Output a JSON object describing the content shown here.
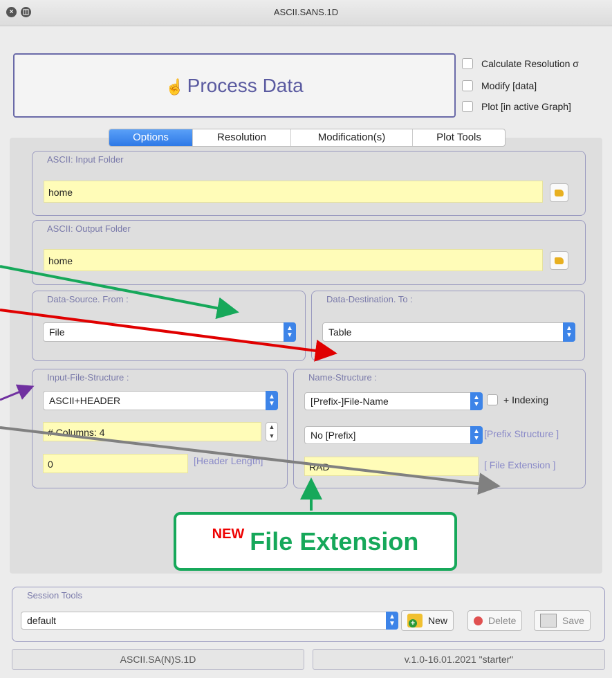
{
  "window": {
    "title": "ASCII.SANS.1D"
  },
  "process": {
    "label": "Process Data"
  },
  "checkboxes": [
    "Calculate Resolution σ",
    "Modify [data]",
    "Plot [in active Graph]"
  ],
  "tabs": [
    "Options",
    "Resolution",
    "Modification(s)",
    "Plot Tools"
  ],
  "input_folder": {
    "title": "ASCII: Input Folder",
    "value": "home"
  },
  "output_folder": {
    "title": "ASCII: Output Folder",
    "value": "home"
  },
  "data_source": {
    "title": "Data-Source. From :",
    "value": "File"
  },
  "data_destination": {
    "title": "Data-Destination. To :",
    "value": "Table"
  },
  "input_structure": {
    "title": "Input-File-Structure :",
    "format": "ASCII+HEADER",
    "columns": "# Columns:  4",
    "header_value": "0",
    "header_hint": "[Header Length]"
  },
  "name_structure": {
    "title": "Name-Structure :",
    "name_format": "[Prefix-]File-Name",
    "indexing_label": "+ Indexing",
    "prefix": "No [Prefix]",
    "prefix_hint": "[Prefix Structure ]",
    "extension_value": "RAD",
    "extension_hint": "[ File Extension ]"
  },
  "callout": {
    "badge": "NEW",
    "text": "File Extension"
  },
  "session": {
    "title": "Session Tools",
    "value": "default",
    "new_label": "New",
    "delete_label": "Delete",
    "save_label": "Save"
  },
  "status": {
    "left": "ASCII.SA(N)S.1D",
    "right": "v.1.0-16.01.2021 \"starter\""
  },
  "colors": {
    "accent": "#2e79e6",
    "field_yellow": "#fffcb8",
    "callout_green": "#16a85a",
    "arrow_red": "#e00000",
    "arrow_purple": "#7030a0",
    "arrow_gray": "#808080"
  }
}
